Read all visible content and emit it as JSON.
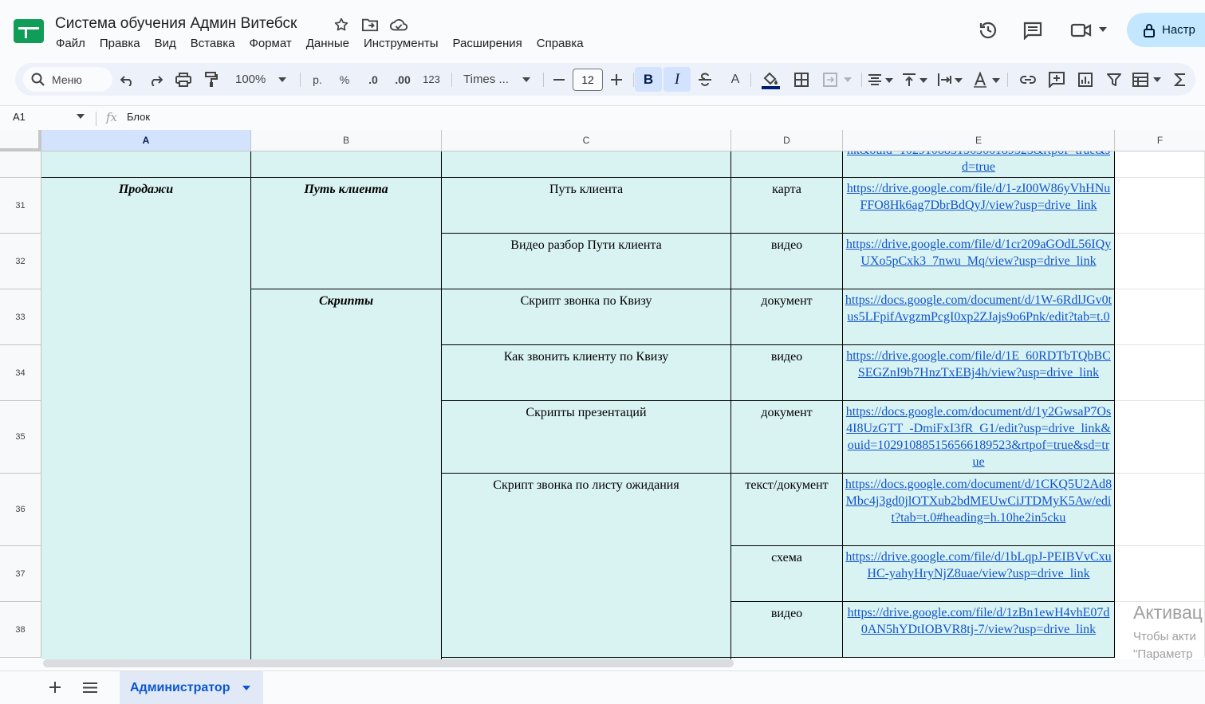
{
  "header": {
    "doc_title": "Система обучения Админ Витебск",
    "menu": [
      "Файл",
      "Правка",
      "Вид",
      "Вставка",
      "Формат",
      "Данные",
      "Инструменты",
      "Расширения",
      "Справка"
    ],
    "share_label": "Настр"
  },
  "toolbar": {
    "search_label": "Меню",
    "zoom": "100%",
    "currency": "р.",
    "percent": "%",
    "dec_dec": ".0",
    "dec_inc": ".00",
    "number_format": "123",
    "font": "Times ...",
    "font_size": "12",
    "bold": "B",
    "italic": "I",
    "text_color": "A"
  },
  "formula_bar": {
    "cell_ref": "A1",
    "fx": "fx",
    "value": "Блок"
  },
  "grid": {
    "columns": [
      "A",
      "B",
      "C",
      "D",
      "E",
      "F"
    ],
    "selected_column": "A",
    "rows": [
      "31",
      "32",
      "33",
      "34",
      "35",
      "36",
      "37",
      "38"
    ],
    "top_partial_link": "nk&ouid=102910885156566189523&rtpof=true&sd=true",
    "a_merged": "Продажи",
    "b_path": "Путь клиента",
    "b_scripts": "Скрипты",
    "c": [
      "Путь клиента",
      "Видео разбор Пути клиента",
      "Скрипт звонка по Квизу",
      "Как звонить клиенту по Квизу",
      "Скрипты презентаций",
      "Скрипт звонка по листу ожидания"
    ],
    "d": [
      "карта",
      "видео",
      "документ",
      "видео",
      "документ",
      "текст/документ",
      "схема",
      "видео"
    ],
    "e": [
      "https://drive.google.com/file/d/1-zI00W86yVhHNuFFO8Hk6ag7DbrBdQyJ/view?usp=drive_link",
      "https://drive.google.com/file/d/1cr209aGOdL56IQyUXo5pCxk3_7nwu_Mq/view?usp=drive_link",
      "https://docs.google.com/document/d/1W-6RdlJGv0tus5LFpifAvgzmPcgI0xp2ZJajs9o6Pnk/edit?tab=t.0",
      "https://drive.google.com/file/d/1E_60RDTbTQbBCSEGZnI9b7HnzTxEBj4h/view?usp=drive_link",
      "https://docs.google.com/document/d/1y2GwsaP7Os4I8UzGTT_-DmiFxI3fR_G1/edit?usp=drive_link&ouid=102910885156566189523&rtpof=true&sd=true",
      "https://docs.google.com/document/d/1CKQ5U2Ad8Mbc4j3gd0jlOTXub2bdMEUwCiJTDMyK5Aw/edit?tab=t.0#heading=h.10he2in5cku",
      "https://drive.google.com/file/d/1bLqpJ-PEIBVvCxuHC-yahyHryNjZ8uae/view?usp=drive_link",
      "https://drive.google.com/file/d/1zBn1ewH4vhE07d0AN5hYDtIOBVR8tj-7/view?usp=drive_link"
    ]
  },
  "sheets": {
    "active": "Администратор"
  },
  "watermark": {
    "line1": "Активац",
    "line2": "Чтобы акти",
    "line3": "\"Параметр"
  }
}
